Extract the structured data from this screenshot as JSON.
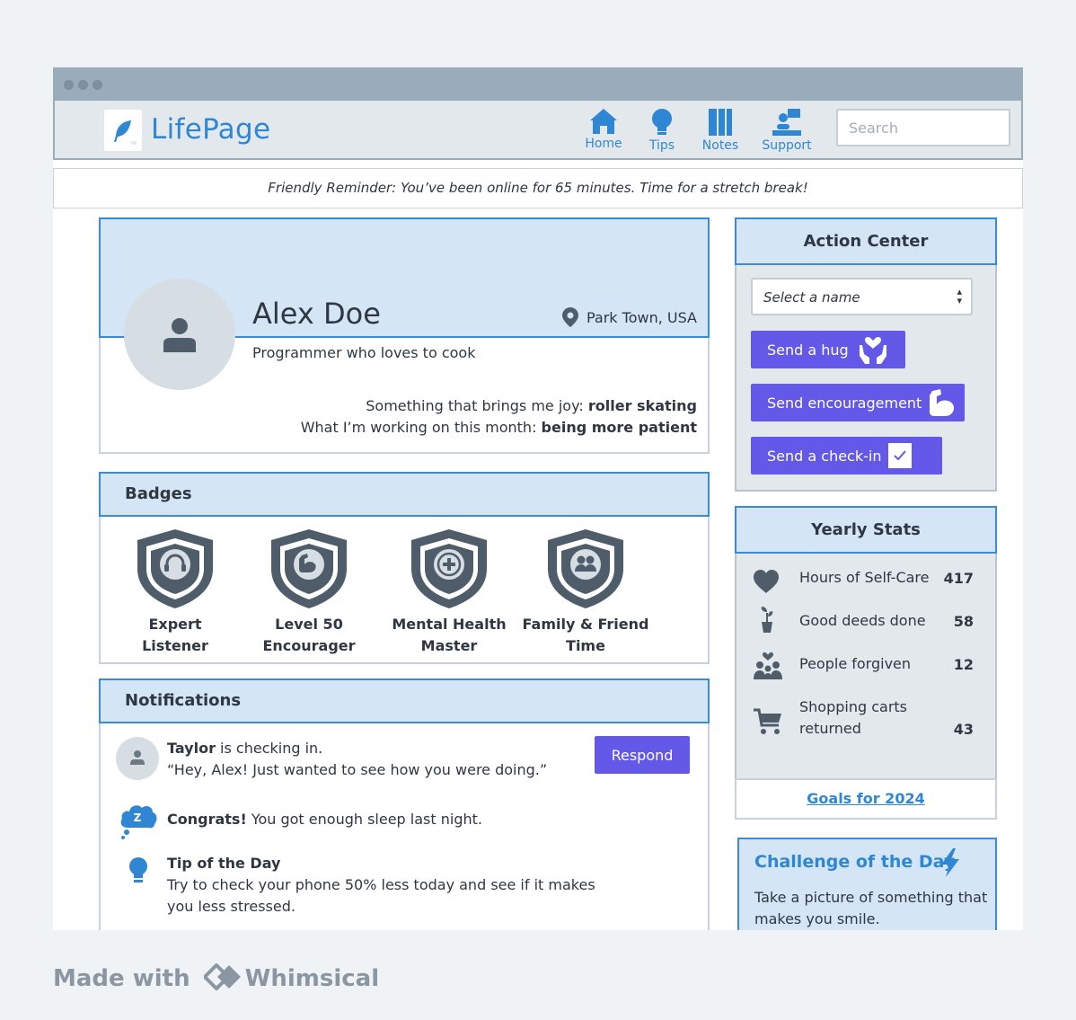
{
  "app": {
    "name": "LifePage",
    "search_placeholder": "Search"
  },
  "nav": [
    {
      "label": "Home",
      "icon": "home-icon"
    },
    {
      "label": "Tips",
      "icon": "lightbulb-icon"
    },
    {
      "label": "Notes",
      "icon": "notes-icon"
    },
    {
      "label": "Support",
      "icon": "support-icon"
    }
  ],
  "reminder": "Friendly Reminder: You’ve been online for 65 minutes. Time for a stretch break!",
  "profile": {
    "name": "Alex Doe",
    "location": "Park Town, USA",
    "tagline": "Programmer who loves to cook",
    "joy_label": "Something that brings me joy:",
    "joy_value": "roller skating",
    "working_label": "What I’m working on this month:",
    "working_value": "being more patient"
  },
  "badges": {
    "title": "Badges",
    "items": [
      {
        "line1": "Expert",
        "line2": "Listener",
        "icon": "headphones-icon"
      },
      {
        "line1": "Level 50",
        "line2": "Encourager",
        "icon": "flexed-arm-icon"
      },
      {
        "line1": "Mental Health",
        "line2": "Master",
        "icon": "plus-icon"
      },
      {
        "line1": "Family & Friend",
        "line2": "Time",
        "icon": "people-icon"
      }
    ]
  },
  "notifications": {
    "title": "Notifications",
    "items": [
      {
        "bold": "Taylor",
        "text": " is checking in.",
        "text2": "“Hey, Alex! Just wanted to see how you were doing.”",
        "action": "Respond"
      },
      {
        "bold": "Congrats!",
        "text": " You got enough sleep last night."
      },
      {
        "bold": "Tip of the Day",
        "text": "Try to check your phone 50% less today and see if it makes",
        "text2": "you less stressed."
      }
    ]
  },
  "action_center": {
    "title": "Action Center",
    "select_value": "Select a name",
    "buttons": [
      "Send a hug",
      "Send encouragement",
      "Send a check-in"
    ]
  },
  "stats": {
    "title": "Yearly Stats",
    "items": [
      {
        "label": "Hours of Self-Care",
        "value": "417",
        "icon": "heart-icon"
      },
      {
        "label": "Good deeds done",
        "value": "58",
        "icon": "seedling-icon"
      },
      {
        "label": "People forgiven",
        "value": "12",
        "icon": "people-heart-icon"
      },
      {
        "label": "Shopping carts",
        "label2": "returned",
        "value": "43",
        "icon": "cart-icon"
      }
    ],
    "goals_link": "Goals for 2024"
  },
  "challenge": {
    "title": "Challenge of the Day",
    "text": "Take a picture of something that makes you smile."
  },
  "footer": {
    "made_with": "Made with",
    "brand": "Whimsical"
  }
}
